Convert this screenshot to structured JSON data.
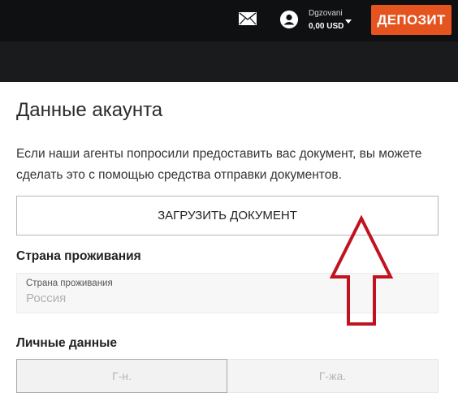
{
  "header": {
    "user_name": "Dgzovani",
    "balance": "0,00 USD",
    "deposit_label": "ДЕПОЗИТ",
    "icons": [
      "mail-icon",
      "user-icon",
      "caret-down-icon"
    ]
  },
  "account": {
    "title": "Данные акаунта",
    "description": "Если наши агенты попросили предоставить вас документ, вы можете сделать это с помощью средства отправки документов.",
    "upload_label": "ЗАГРУЗИТЬ ДОКУМЕНТ"
  },
  "residence": {
    "section_label": "Страна проживания",
    "field_caption": "Страна проживания",
    "field_value": "Россия"
  },
  "personal": {
    "section_label": "Личные данные",
    "gender_options": [
      "Г-н.",
      "Г-жа."
    ]
  },
  "colors": {
    "topbar": "#0f1012",
    "accent": "#e5531f",
    "annotation_arrow": "#c1121f"
  }
}
